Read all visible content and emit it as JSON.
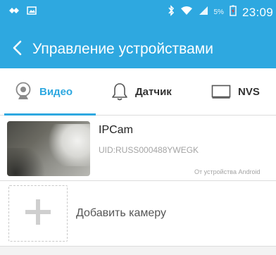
{
  "status_bar": {
    "battery_percent": "5%",
    "time": "23:09"
  },
  "header": {
    "title": "Управление устройствами"
  },
  "tabs": [
    {
      "label": "Видео",
      "icon": "webcam-icon",
      "active": true
    },
    {
      "label": "Датчик",
      "icon": "bell-icon",
      "active": false
    },
    {
      "label": "NVS",
      "icon": "monitor-icon",
      "active": false
    }
  ],
  "devices": [
    {
      "name": "IPCam",
      "uid": "UID:RUSS000488YWEGK",
      "source": "От устройства Android"
    }
  ],
  "add_camera": {
    "label": "Добавить камеру"
  },
  "colors": {
    "accent": "#2ea8e0",
    "background": "#f3f3f3"
  }
}
